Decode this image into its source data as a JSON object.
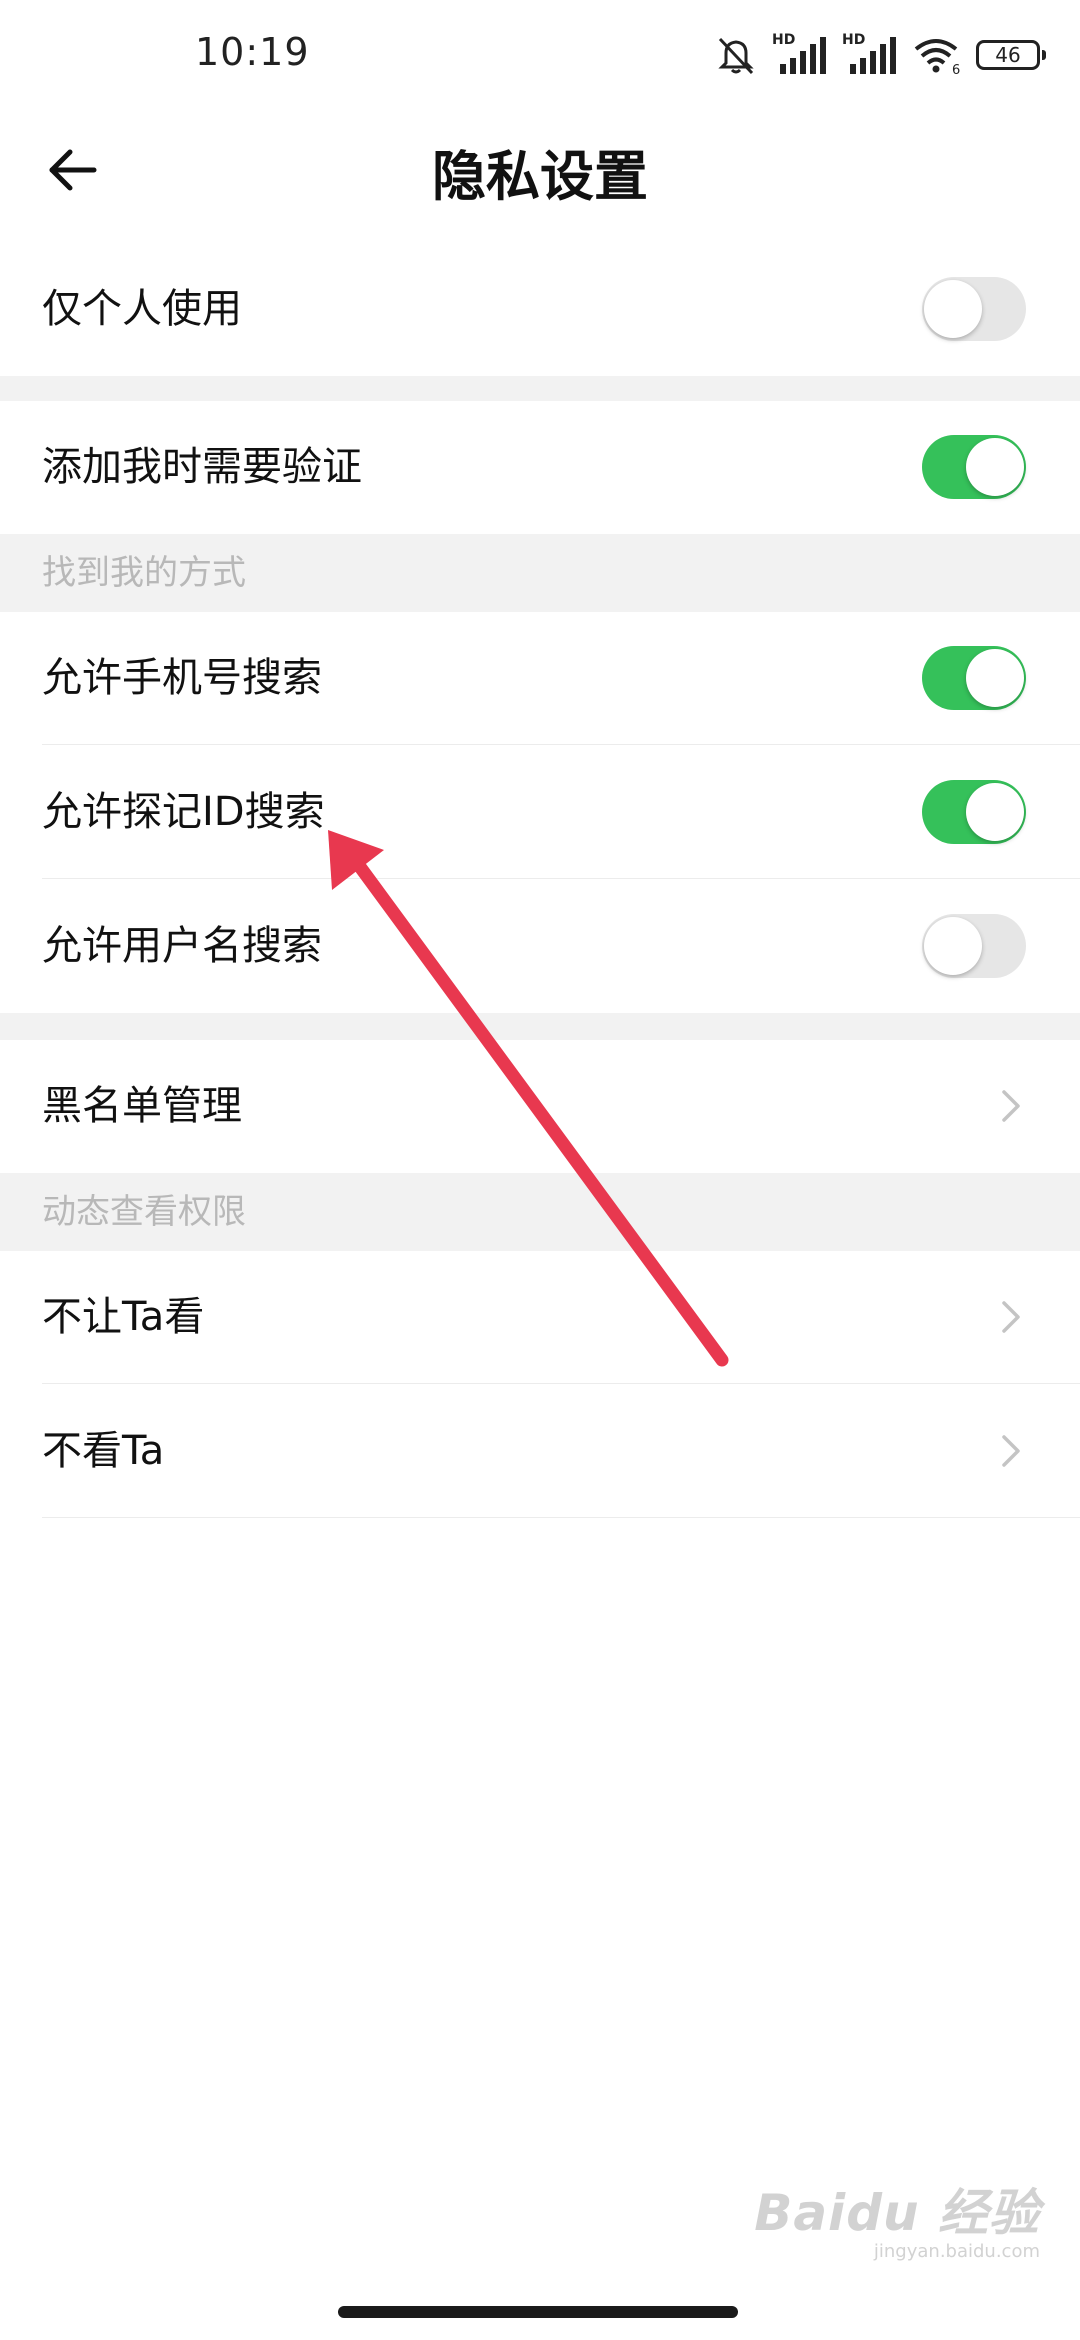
{
  "status_bar": {
    "time": "10:19",
    "hd_label_1": "HD",
    "hd_label_2": "HD",
    "wifi_badge": "6",
    "battery": "46",
    "icons": [
      "mute-icon",
      "signal-icon",
      "signal-icon",
      "wifi-icon",
      "battery-icon"
    ]
  },
  "header": {
    "title": "隐私设置",
    "back_icon": "arrow-left-icon"
  },
  "rows": {
    "personal_use": {
      "label": "仅个人使用",
      "enabled": false
    },
    "add_verify": {
      "label": "添加我时需要验证",
      "enabled": true
    },
    "phone_search": {
      "label": "允许手机号搜索",
      "enabled": true
    },
    "tanji_id_search": {
      "label": "允许探记ID搜索",
      "enabled": true
    },
    "username_search": {
      "label": "允许用户名搜索",
      "enabled": false
    },
    "blacklist": {
      "label": "黑名单管理"
    },
    "hide_from": {
      "label": "不让Ta看"
    },
    "dont_see": {
      "label": "不看Ta"
    }
  },
  "sections": {
    "find_me": "找到我的方式",
    "moments_permissions": "动态查看权限"
  },
  "watermark": {
    "brand": "Baidu 经验",
    "url": "jingyan.baidu.com"
  },
  "colors": {
    "toggle_on": "#35c15a",
    "toggle_off": "#e6e6e6",
    "section_bg": "#f2f2f2",
    "annotation_arrow": "#e8384f"
  }
}
